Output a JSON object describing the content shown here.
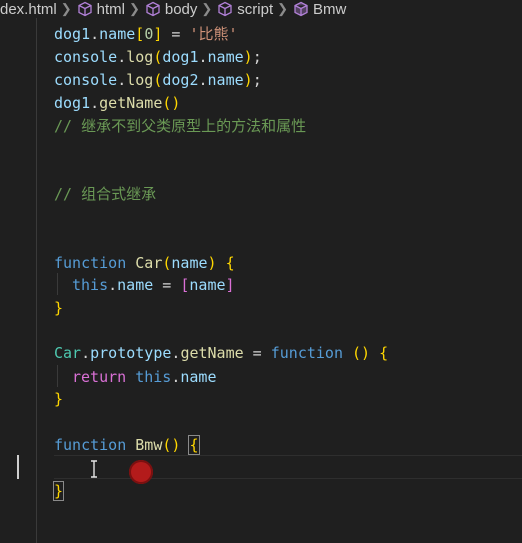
{
  "breadcrumb": {
    "items": [
      {
        "label": "dex.html",
        "icon": "none"
      },
      {
        "label": "html",
        "icon": "cube-icon"
      },
      {
        "label": "body",
        "icon": "cube-icon"
      },
      {
        "label": "script",
        "icon": "cube-icon"
      },
      {
        "label": "Bmw",
        "icon": "method-icon"
      }
    ]
  },
  "code": {
    "line1": {
      "obj": "dog1",
      "prop": "name",
      "index": "0",
      "str": "'比熊'"
    },
    "line2": {
      "console": "console",
      "log": "log",
      "arg_obj": "dog1",
      "arg_prop": "name"
    },
    "line3": {
      "console": "console",
      "log": "log",
      "arg_obj": "dog2",
      "arg_prop": "name"
    },
    "line4": {
      "obj": "dog1",
      "method": "getName"
    },
    "comment1": "// 继承不到父类原型上的方法和属性",
    "comment2": "// 组合式继承",
    "car_fn": {
      "kw": "function",
      "name": "Car",
      "param": "name"
    },
    "car_body": {
      "this": "this",
      "prop": "name",
      "val": "name"
    },
    "proto": {
      "cls": "Car",
      "proto": "prototype",
      "method": "getName",
      "kw": "function"
    },
    "proto_body": {
      "ret": "return",
      "this": "this",
      "prop": "name"
    },
    "bmw_fn": {
      "kw": "function",
      "name": "Bmw"
    }
  },
  "colors": {
    "background": "#1f1f1f",
    "keyword": "#569cd6",
    "function": "#dcdcaa",
    "class": "#4ec9b0",
    "variable": "#9cdcfe",
    "string": "#ce9178",
    "number": "#b5cea8",
    "comment": "#6a9955",
    "bracket": "#ffd700",
    "recording_dot": "#b31b1b"
  }
}
